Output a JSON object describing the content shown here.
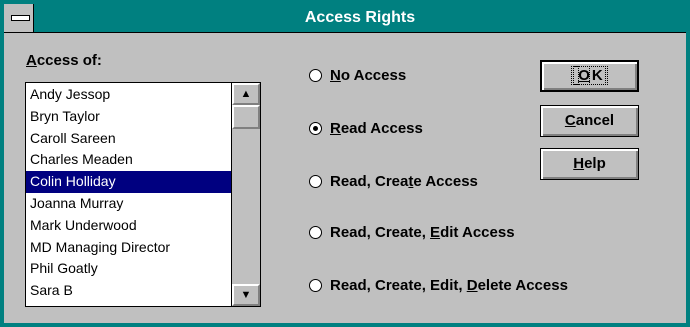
{
  "window": {
    "title": "Access Rights"
  },
  "colors": {
    "titlebar": "#008080",
    "selection": "#000080",
    "face": "#c0c0c0"
  },
  "list": {
    "label_accel": "A",
    "label_rest": "ccess of:",
    "items": [
      "Andy Jessop",
      "Bryn Taylor",
      "Caroll Sareen",
      "Charles Meaden",
      "Colin Holliday",
      "Joanna Murray",
      "Mark Underwood",
      "MD Managing Director",
      "Phil Goatly",
      "Sara B"
    ],
    "selected": "Colin Holliday"
  },
  "options": [
    {
      "pre": "",
      "accel": "N",
      "post": "o Access",
      "checked": false
    },
    {
      "pre": "",
      "accel": "R",
      "post": "ead Access",
      "checked": true
    },
    {
      "pre": "Read, Crea",
      "accel": "t",
      "post": "e Access",
      "checked": false
    },
    {
      "pre": "Read, Create, ",
      "accel": "E",
      "post": "dit Access",
      "checked": false
    },
    {
      "pre": "Read, Create, Edit, ",
      "accel": "D",
      "post": "elete Access",
      "checked": false
    }
  ],
  "buttons": {
    "ok": {
      "pre": "",
      "accel": "O",
      "post": "K"
    },
    "cancel": {
      "pre": "",
      "accel": "C",
      "post": "ancel"
    },
    "help": {
      "pre": "",
      "accel": "H",
      "post": "elp"
    }
  },
  "scrollbar": {
    "up_icon": "arrow-up",
    "down_icon": "arrow-down"
  }
}
